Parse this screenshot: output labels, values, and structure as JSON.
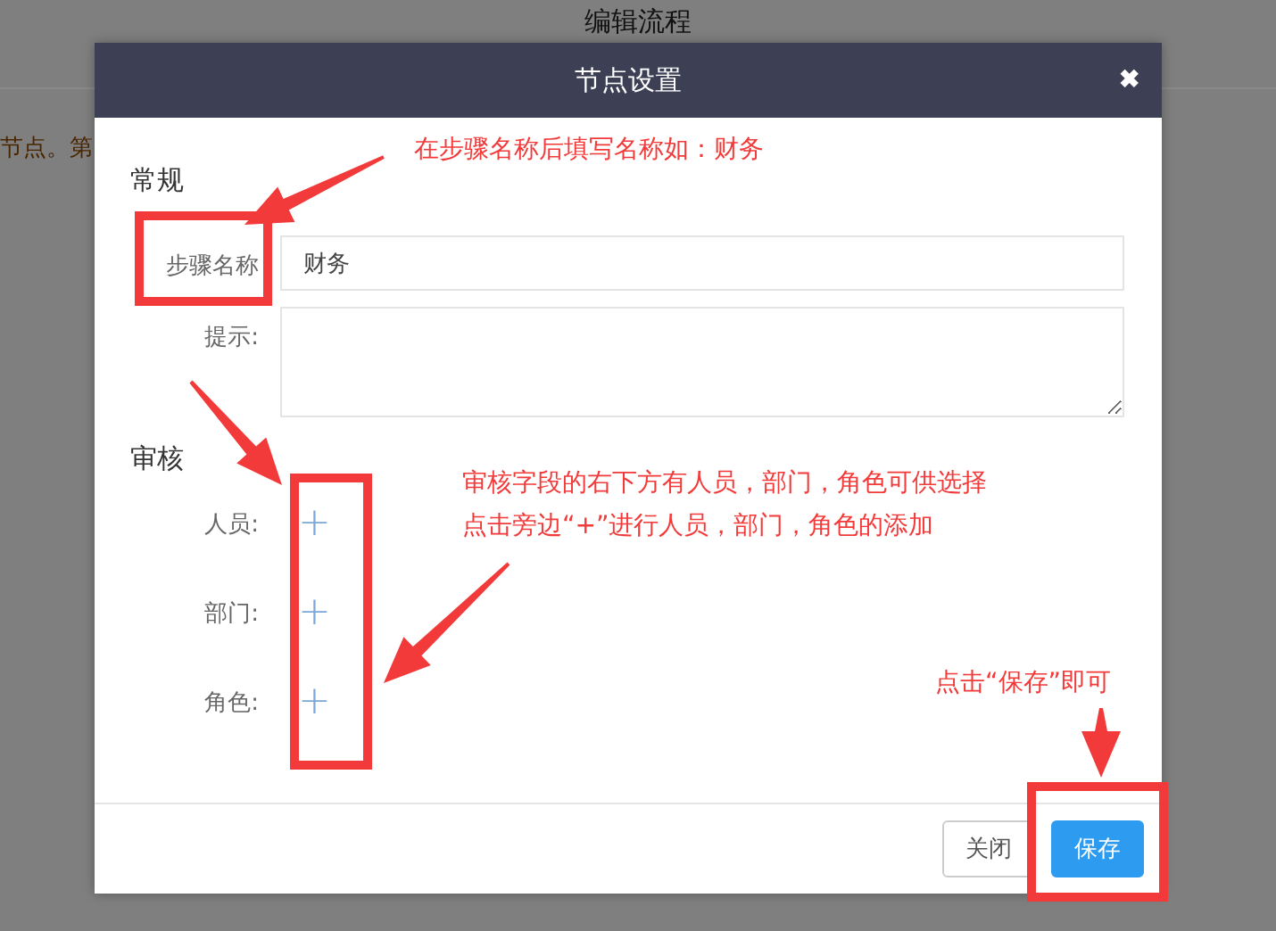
{
  "background_page": {
    "title": "编辑流程",
    "notice": "节点。第"
  },
  "dialog": {
    "title": "节点设置",
    "close": "✖",
    "sections": [
      {
        "title": "常规",
        "fields": [
          {
            "kind": "input",
            "label": "步骤名称",
            "value": "财务"
          },
          {
            "kind": "textarea",
            "label": "提示:"
          }
        ]
      },
      {
        "title": "审核",
        "fields": [
          {
            "kind": "add",
            "label": "人员:",
            "icon": "+"
          },
          {
            "kind": "add",
            "label": "部门:",
            "icon": "+"
          },
          {
            "kind": "add",
            "label": "角色:",
            "icon": "+"
          }
        ]
      }
    ],
    "buttons": [
      {
        "label": "关闭",
        "kind": "default"
      },
      {
        "label": "保存",
        "kind": "primary"
      }
    ]
  },
  "annotations": [
    {
      "text": "在步骤名称后填写名称如：财务"
    },
    {
      "text": "审核字段的右下方有人员，部门，角色可供选择"
    },
    {
      "text": "点击旁边“+”进行人员，部门，角色的添加"
    },
    {
      "text": "点击“保存”即可"
    }
  ]
}
